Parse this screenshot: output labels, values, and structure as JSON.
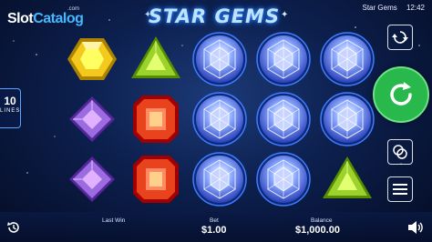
{
  "logo": {
    "prefix": "SlotCatalog",
    "main_a": "Slot",
    "main_b": "Catalog",
    "suffix": ".com"
  },
  "game": {
    "title": "STAR GEMS"
  },
  "status": {
    "game_name": "Star Gems",
    "time": "12:42"
  },
  "lines": {
    "count": "10",
    "label": "LINES"
  },
  "reels": {
    "columns": 5,
    "rows": 3,
    "symbols": [
      [
        "yellow-gem",
        "green-gem",
        "blue-diamond",
        "blue-diamond",
        "blue-diamond"
      ],
      [
        "purple-gem",
        "red-gem",
        "blue-diamond",
        "blue-diamond",
        "blue-diamond"
      ],
      [
        "purple-gem",
        "red-gem",
        "blue-diamond",
        "blue-diamond",
        "green-gem"
      ]
    ]
  },
  "colors": {
    "yellow-gem": "#f2c91c",
    "green-gem": "#9cd22c",
    "purple-gem": "#9b6be0",
    "red-gem": "#e8431c",
    "blue-diamond": "#8aa8ff",
    "spin": "#28b84b"
  },
  "footer": {
    "last_win_label": "Last Win",
    "last_win_value": "",
    "bet_label": "Bet",
    "bet_value": "$1.00",
    "balance_label": "Balance",
    "balance_value": "$1,000.00"
  },
  "controls": {
    "autoplay": "autoplay-icon",
    "spin": "spin-icon",
    "coins": "coins-icon",
    "menu": "menu-icon",
    "history": "history-icon",
    "sound": "speaker-icon"
  }
}
